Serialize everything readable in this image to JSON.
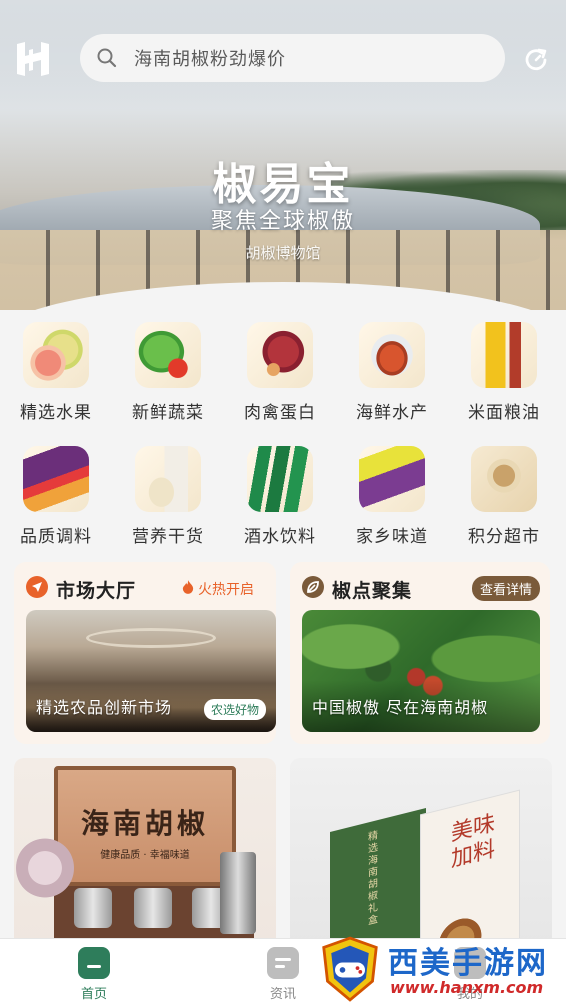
{
  "search": {
    "placeholder": "海南胡椒粉劲爆价"
  },
  "hero": {
    "title": "椒易宝",
    "subtitle": "聚焦全球椒傲",
    "museum": "胡椒博物馆"
  },
  "categories": [
    {
      "label": "精选水果",
      "icon": "pomelo-fruit-icon"
    },
    {
      "label": "新鲜蔬菜",
      "icon": "vegetables-icon"
    },
    {
      "label": "肉禽蛋白",
      "icon": "meat-egg-icon"
    },
    {
      "label": "海鲜水产",
      "icon": "crab-seafood-icon"
    },
    {
      "label": "米面粮油",
      "icon": "cooking-oil-icon"
    },
    {
      "label": "品质调料",
      "icon": "seasoning-pack-icon"
    },
    {
      "label": "营养干货",
      "icon": "dried-goods-icon"
    },
    {
      "label": "酒水饮料",
      "icon": "beer-bottles-icon"
    },
    {
      "label": "家乡味道",
      "icon": "hometown-snack-icon"
    },
    {
      "label": "积分超市",
      "icon": "points-mall-icon"
    }
  ],
  "market": {
    "title": "市场大厅",
    "badge": "火热开启",
    "caption": "精选农品创新市场",
    "tag": "农选好物"
  },
  "pepper": {
    "title": "椒点聚集",
    "badge": "查看详情",
    "caption": "中国椒傲 尽在海南胡椒"
  },
  "products": [
    {
      "box_text": "海南胡椒",
      "box_sub": "健康品质 · 幸福味道"
    },
    {
      "box_text": "美味加料",
      "box_green": "精选海南胡椒礼盒"
    }
  ],
  "tabbar": {
    "home": "首页",
    "news": "资讯",
    "mine": "我的"
  },
  "watermark": {
    "text": "西美手游网",
    "url": "www.hanxm.com"
  },
  "colors": {
    "accent": "#2e7d5b",
    "card_bg": "#fbf3ec",
    "badge_orange": "#e8622a",
    "badge_brown": "#7a5a3a"
  }
}
